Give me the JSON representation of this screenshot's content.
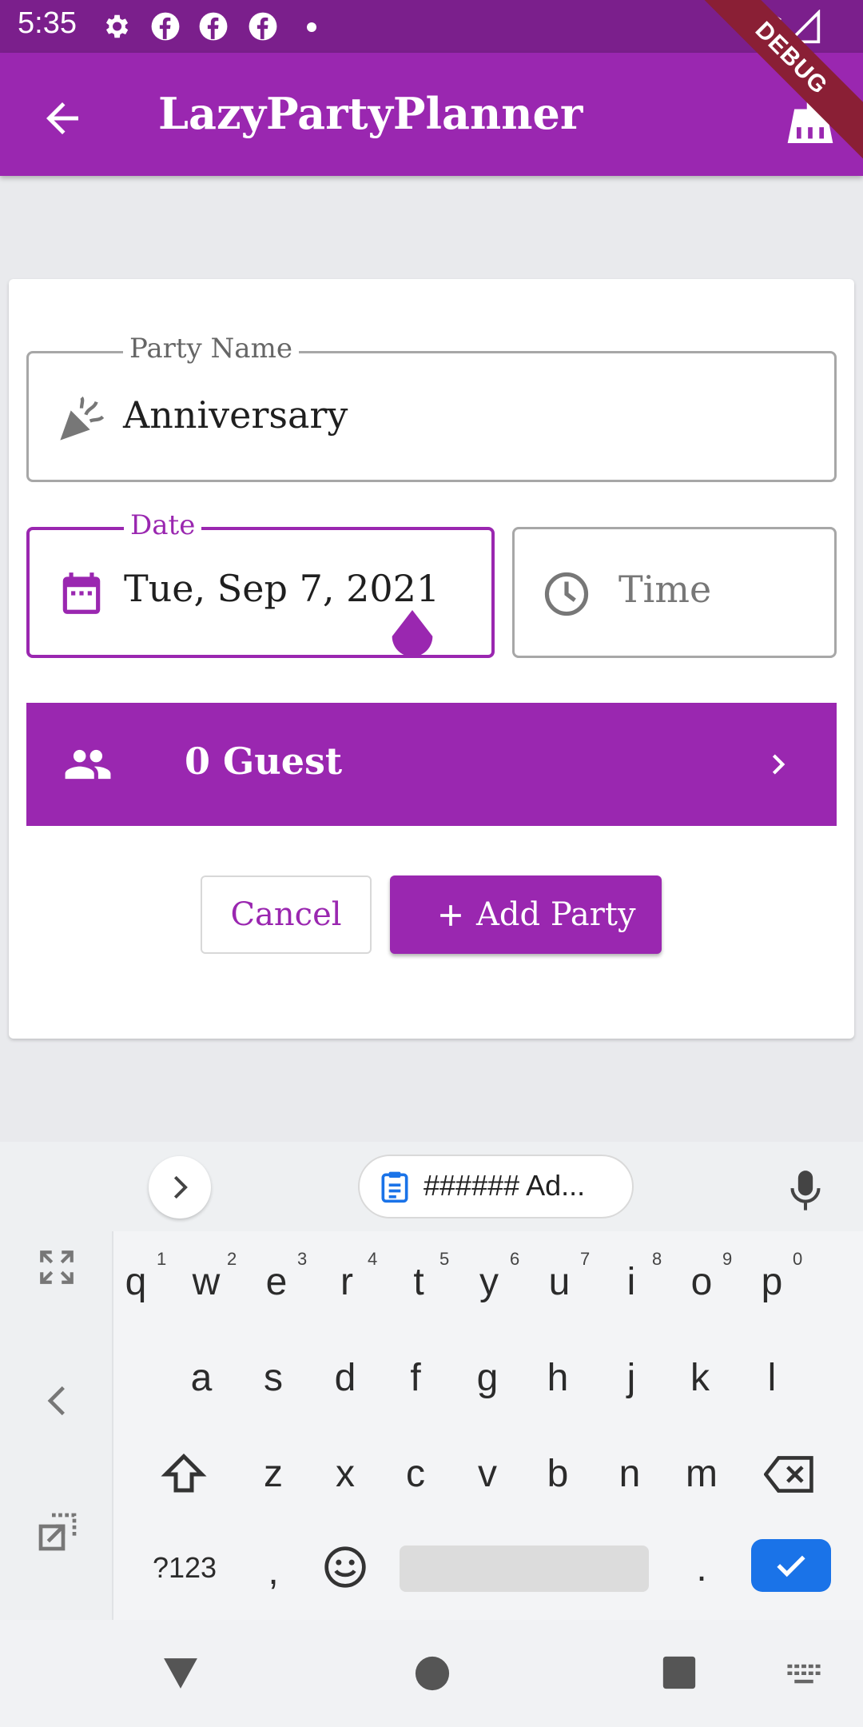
{
  "status_bar": {
    "time": "5:35",
    "icons": [
      "settings-icon",
      "facebook-icon",
      "facebook-icon",
      "facebook-icon",
      "dot-icon",
      "wifi-icon",
      "signal-icon"
    ]
  },
  "app_bar": {
    "title": "LazyPartyPlanner",
    "back_icon": "arrow-back-icon",
    "action_icon": "broom-icon",
    "debug_banner": "DEBUG"
  },
  "form": {
    "party_name": {
      "label": "Party Name",
      "value": "Anniversary",
      "icon": "party-popper-icon"
    },
    "date": {
      "label": "Date",
      "value": "Tue, Sep 7, 2021",
      "icon": "calendar-icon"
    },
    "time": {
      "placeholder": "Time",
      "icon": "clock-icon"
    },
    "guests": {
      "label": "0 Guest",
      "icon": "people-icon",
      "chevron": "chevron-right-icon"
    },
    "cancel_label": "Cancel",
    "add_label": "Add Party"
  },
  "keyboard": {
    "clipboard_text": "###### Ad...",
    "row1": [
      "q",
      "w",
      "e",
      "r",
      "t",
      "y",
      "u",
      "i",
      "o",
      "p"
    ],
    "row1_hints": [
      "1",
      "2",
      "3",
      "4",
      "5",
      "6",
      "7",
      "8",
      "9",
      "0"
    ],
    "row2": [
      "a",
      "s",
      "d",
      "f",
      "g",
      "h",
      "j",
      "k",
      "l"
    ],
    "row3": [
      "z",
      "x",
      "c",
      "v",
      "b",
      "n",
      "m"
    ],
    "symbols_label": "?123",
    "comma": ",",
    "period": "."
  },
  "colors": {
    "primary": "#9a27b0",
    "status_bar": "#7b1f8c",
    "enter_key": "#1a73e8"
  }
}
